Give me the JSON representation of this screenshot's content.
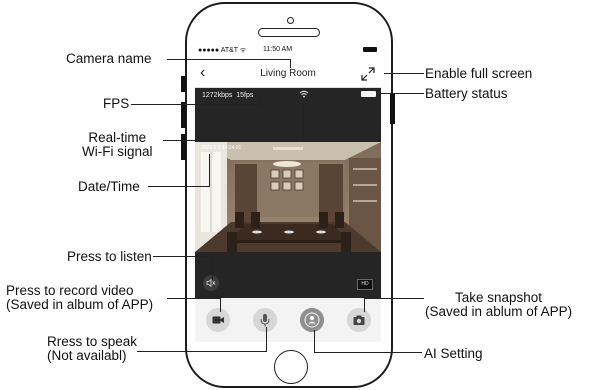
{
  "status_bar": {
    "carrier": "●●●●● AT&T ᯤ",
    "time": "11:50 AM"
  },
  "nav": {
    "back_glyph": "‹",
    "camera_name": "Living Room"
  },
  "stream": {
    "bitrate": "1272kbps",
    "fps": "15fps",
    "timestamp": "2023.1.3 14:24:01",
    "hd_label": "HD"
  },
  "annotations": {
    "camera_name": "Camera name",
    "fps": "FPS",
    "wifi_line1": "Real-time",
    "wifi_line2": "Wi-Fi signal",
    "datetime": "Date/Time",
    "listen": "Press to listen",
    "record_line1": "Press to record video",
    "record_line2": "(Saved in album of APP)",
    "speak_line1": "Rress to speak",
    "speak_line2": "(Not availabl)",
    "fullscreen": "Enable full screen",
    "battery": "Battery status",
    "snapshot_line1": "Take snapshot",
    "snapshot_line2": "(Saved in ablum of APP)",
    "ai": "AI Setting"
  },
  "icons": [
    "back-icon",
    "fullscreen-icon",
    "wifi-icon",
    "battery-icon",
    "speaker-mute-icon",
    "video-camera-icon",
    "microphone-icon",
    "ai-person-icon",
    "camera-snapshot-icon"
  ]
}
